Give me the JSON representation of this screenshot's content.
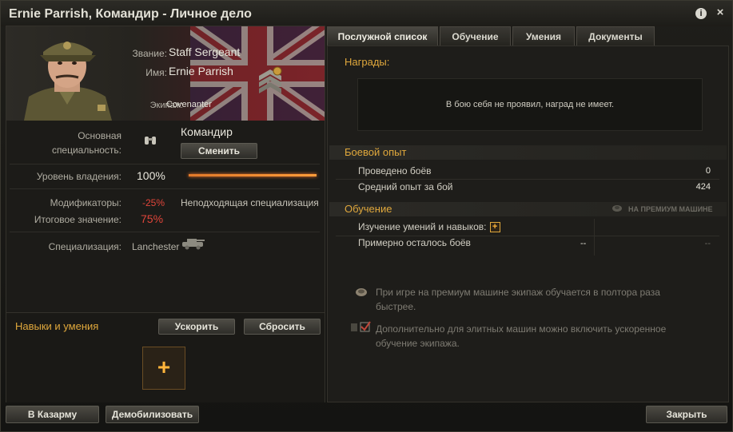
{
  "window": {
    "title": "Ernie Parrish, Командир - Личное дело",
    "help_glyph": "i",
    "close_glyph": "×"
  },
  "profile": {
    "rank_label": "Звание:",
    "rank_value": "Staff Sergeant",
    "name_label": "Имя:",
    "name_value": "Ernie Parrish",
    "crew_label": "Экипаж:",
    "crew_value": "Covenanter"
  },
  "specialty": {
    "main_label_line1": "Основная",
    "main_label_line2": "специальность:",
    "role": "Командир",
    "change_button": "Сменить",
    "mastery_label": "Уровень владения:",
    "mastery_value": "100%",
    "mastery_level": 1.0,
    "modifiers_label": "Модификаторы:",
    "modifiers_value": "-25%",
    "modifiers_note": "Неподходящая специализация",
    "total_label": "Итоговое значение:",
    "total_value": "75%",
    "specialization_label": "Специализация:",
    "specialization_value": "Lanchester"
  },
  "skills": {
    "title": "Навыки и умения",
    "accelerate_button": "Ускорить",
    "reset_button": "Сбросить",
    "add_glyph": "+"
  },
  "tabs": [
    "Послужной список",
    "Обучение",
    "Умения",
    "Документы"
  ],
  "record": {
    "awards_title": "Награды:",
    "awards_empty": "В бою себя не проявил, наград не имеет.",
    "combat_title": "Боевой опыт",
    "battles_label": "Проведено боёв",
    "battles_value": "0",
    "avg_xp_label": "Средний опыт за бой",
    "avg_xp_value": "424",
    "training_title": "Обучение",
    "premium_tag": "НА ПРЕМИУМ МАШИНЕ",
    "skills_learning_label": "Изучение умений и навыков:",
    "battles_left_label": "Примерно осталось боёв",
    "battles_left_value": "--",
    "battles_left_premium_value": "--",
    "info_premium_line1": "При игре на премиум машине экипаж обучается в полтора раза",
    "info_premium_line2": "быстрее.",
    "info_elite_line1": "Дополнительно для элитных машин можно включить ускоренное",
    "info_elite_line2": "обучение экипажа."
  },
  "footer": {
    "barracks_button": "В Казарму",
    "demobilize_button": "Демобилизовать",
    "close_button": "Закрыть"
  },
  "colors": {
    "accent_orange": "#e0a83c",
    "negative_red": "#e0453a",
    "progress": "#ff8a30"
  }
}
